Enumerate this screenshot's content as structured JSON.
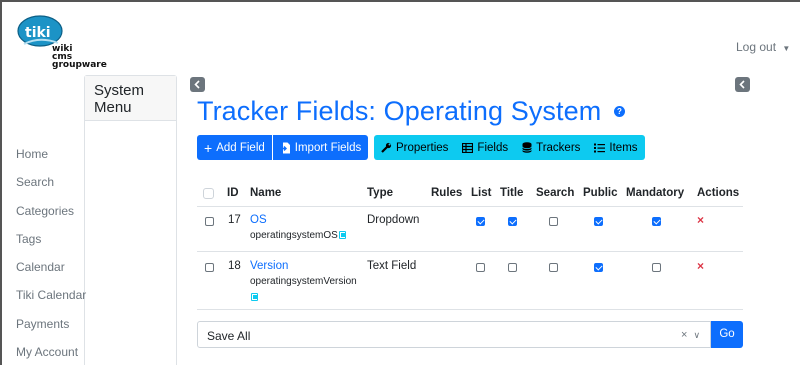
{
  "app": {
    "logo_word_1": "wiki",
    "logo_word_2": "cms",
    "logo_word_3": "groupware",
    "logo_badge": "tiki",
    "logout_label": "Log out"
  },
  "sidebar": {
    "title_line_1": "System",
    "title_line_2": "Menu",
    "items": [
      "Home",
      "Search",
      "Categories",
      "Tags",
      "Calendar",
      "Tiki Calendar",
      "Payments",
      "My Account"
    ]
  },
  "page": {
    "title": "Tracker Fields: Operating System",
    "help_glyph": "?"
  },
  "toolbar": {
    "add_field": "Add Field",
    "import_fields": "Import Fields",
    "properties": "Properties",
    "fields": "Fields",
    "trackers": "Trackers",
    "items": "Items"
  },
  "table": {
    "headers": [
      "ID",
      "Name",
      "Type",
      "Rules",
      "List",
      "Title",
      "Search",
      "Public",
      "Mandatory",
      "Actions"
    ],
    "rows": [
      {
        "id": "17",
        "name": "OS",
        "permname": "operatingsystemOS",
        "type": "Dropdown",
        "list": true,
        "title": true,
        "search": false,
        "public": true,
        "mandatory": true
      },
      {
        "id": "18",
        "name": "Version",
        "permname": "operatingsystemVersion",
        "type": "Text Field",
        "list": false,
        "title": false,
        "search": false,
        "public": true,
        "mandatory": false
      }
    ],
    "delete_glyph": "×"
  },
  "bulk": {
    "selected": "Save All",
    "clear_glyph": "×",
    "go_label": "Go"
  },
  "colors": {
    "primary": "#0d6efd",
    "info": "#0dcaf0",
    "danger": "#dc3545",
    "muted": "#6c757d"
  }
}
